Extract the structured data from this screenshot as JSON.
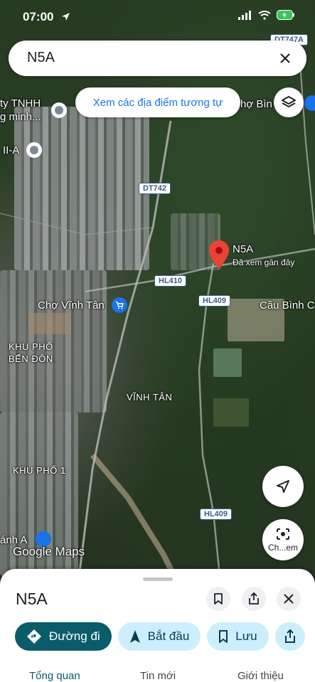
{
  "status_bar": {
    "time": "07:00"
  },
  "search": {
    "query": "N5A"
  },
  "similar_places_chip": "Xem các địa điểm tương tự",
  "map_labels": {
    "company_partial_line1": "ty TNHH",
    "company_partial_line2": "g minh...",
    "kcn_partial": "II-A",
    "cho_binh_partial": "hợ Bìn",
    "cho_vinh_tan": "Chợ Vĩnh Tân",
    "pin_title": "N5A",
    "pin_subtitle": "Đã xem gần đây",
    "cau_binh": "Cầu Bình C",
    "khu_pho_ben_don_1": "KHU PHỐ",
    "khu_pho_ben_don_2": "BẾN ĐÔN",
    "vinh_tan": "VĨNH TÂN",
    "khu_pho_1": "KHU PHỐ 1",
    "canh_a_partial": "ánh A",
    "google_maps": "Google Maps"
  },
  "road_shields": {
    "dt747a": "DT747A",
    "dt742": "DT742",
    "hl410": "HL410",
    "hl409_top": "HL409",
    "hl409_bottom": "HL409"
  },
  "round_buttons": {
    "street_view_label": "Ch...em"
  },
  "sheet": {
    "title": "N5A",
    "actions": {
      "directions": "Đường đi",
      "start": "Bắt đầu",
      "save": "Lưu"
    },
    "tabs": {
      "overview": "Tổng quan",
      "updates": "Tin mới",
      "about": "Giới thiệu"
    }
  },
  "colors": {
    "accent": "#0b5c6b",
    "chip_text": "#1a73e8",
    "pin": "#ea4335",
    "shopping_poi": "#1a73e8"
  }
}
